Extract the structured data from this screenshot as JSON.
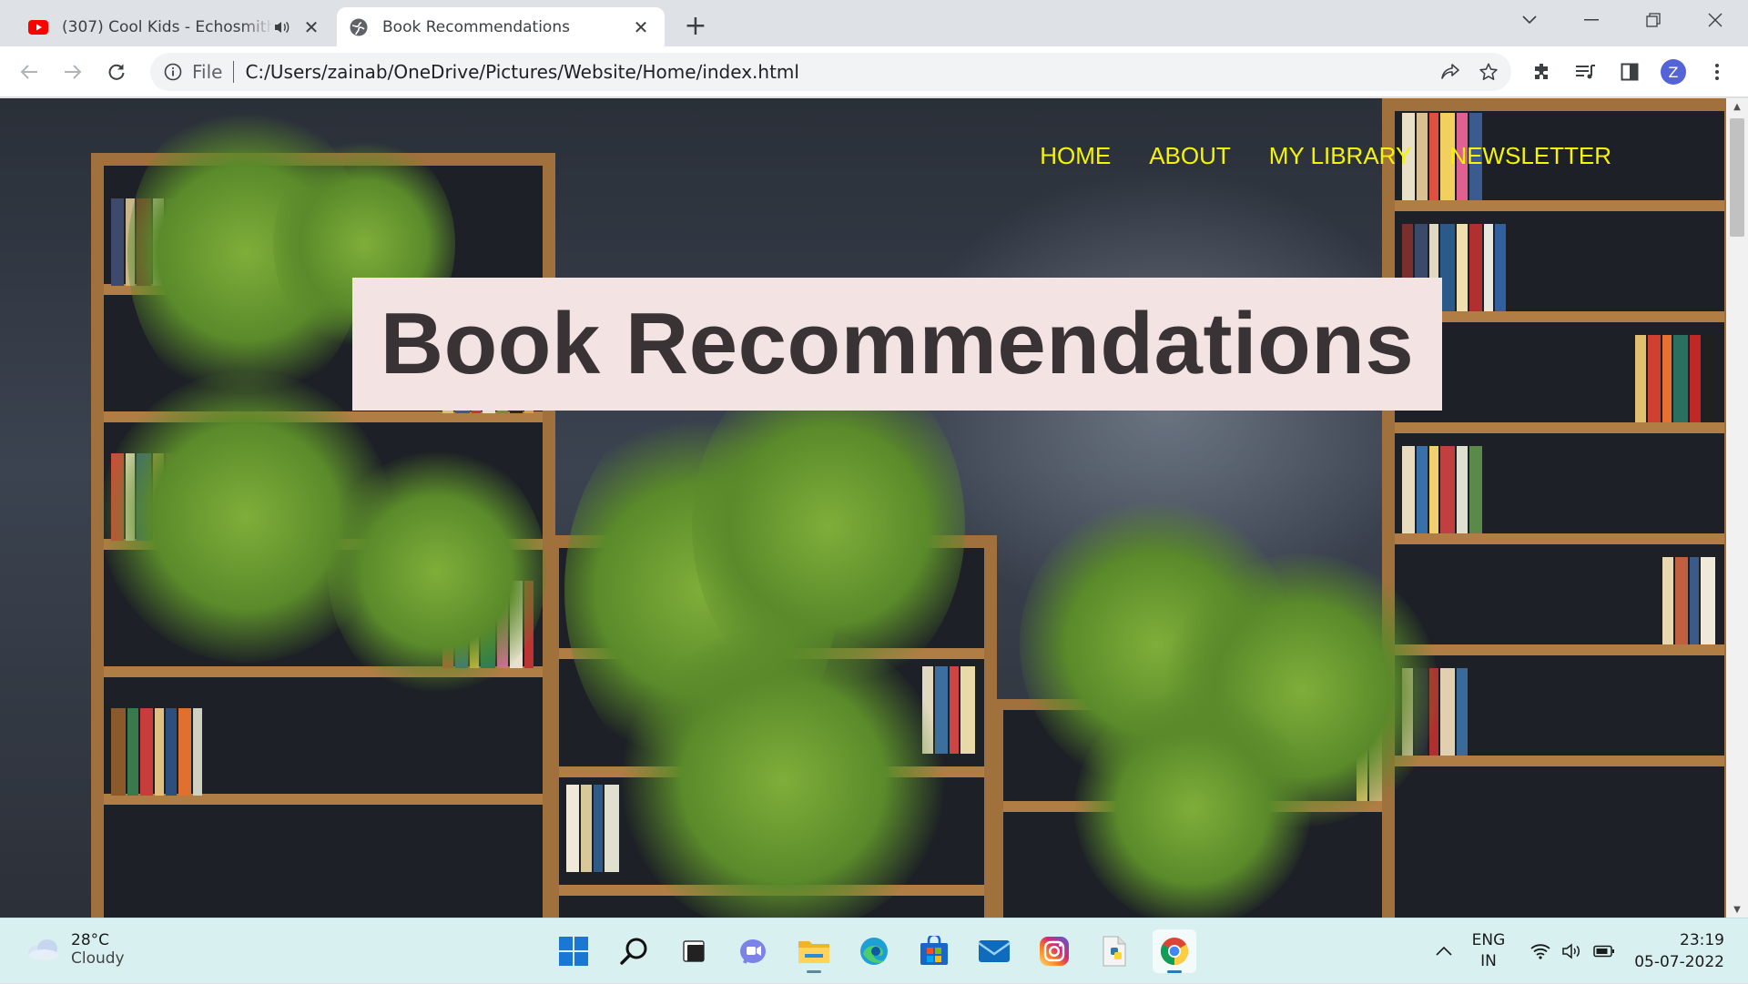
{
  "browser": {
    "tabs": [
      {
        "title": "(307) Cool Kids - Echosmith (",
        "favicon": "youtube-icon",
        "audible": true
      },
      {
        "title": "Book Recommendations",
        "favicon": "globe-icon",
        "active": true
      }
    ],
    "address": {
      "scheme_label": "File",
      "url": "C:/Users/zainab/OneDrive/Pictures/Website/Home/index.html"
    },
    "profile_initial": "Z"
  },
  "page": {
    "nav": [
      "HOME",
      "ABOUT",
      "MY LIBRARY",
      "NEWSLETTER"
    ],
    "hero_title": "Book Recommendations",
    "colors": {
      "nav": "#f5f500",
      "hero_bg": "#f3e3e3",
      "hero_text": "#3a3336"
    }
  },
  "taskbar": {
    "weather": {
      "temp": "28°C",
      "condition": "Cloudy"
    },
    "lang": {
      "line1": "ENG",
      "line2": "IN"
    },
    "clock": {
      "time": "23:19",
      "date": "05-07-2022"
    }
  }
}
